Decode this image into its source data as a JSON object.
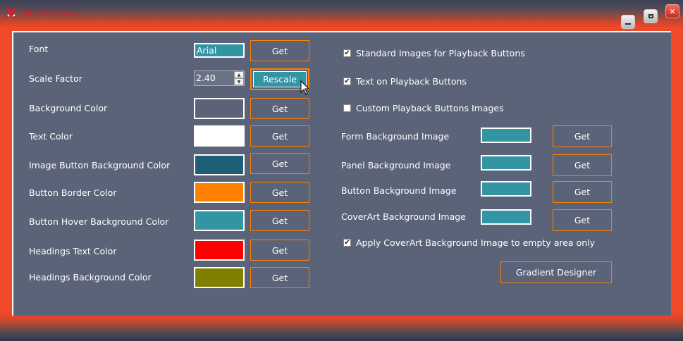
{
  "window": {
    "title": "Skin Settings",
    "minimize_icon": "minimize-icon",
    "maximize_icon": "maximize-icon",
    "close_icon": "close-icon"
  },
  "left": {
    "font": {
      "label": "Font",
      "value": "Arial",
      "get": "Get"
    },
    "scale": {
      "label": "Scale Factor",
      "value": "2.40",
      "button": "Rescale"
    },
    "colors": [
      {
        "label": "Background Color",
        "swatch": "#5a6377",
        "get": "Get"
      },
      {
        "label": "Text Color",
        "swatch": "#ffffff",
        "get": "Get"
      },
      {
        "label": "Image Button Background Color",
        "swatch": "#1e5f78",
        "get": "Get"
      },
      {
        "label": "Button Border Color",
        "swatch": "#ff8000",
        "get": "Get"
      },
      {
        "label": "Button Hover Background Color",
        "swatch": "#3394a4",
        "get": "Get"
      },
      {
        "label": "Headings Text Color",
        "swatch": "#ff0000",
        "get": "Get"
      },
      {
        "label": "Headings Background Color",
        "swatch": "#808000",
        "get": "Get"
      }
    ]
  },
  "right": {
    "checkboxes": [
      {
        "label": "Standard Images for Playback Buttons",
        "checked": true
      },
      {
        "label": "Text on Playback Buttons",
        "checked": true
      },
      {
        "label": "Custom Playback Buttons Images",
        "checked": false
      }
    ],
    "images": [
      {
        "label": "Form Background Image",
        "swatch": "#3394a4",
        "get": "Get"
      },
      {
        "label": "Panel Background Image",
        "swatch": "#3394a4",
        "get": "Get"
      },
      {
        "label": "Button Background Image",
        "swatch": "#3394a4",
        "get": "Get"
      },
      {
        "label": "CoverArt Background Image",
        "swatch": "#3394a4",
        "get": "Get"
      }
    ],
    "apply_checkbox": {
      "label": "Apply CoverArt Background Image to empty area only",
      "checked": true
    },
    "gradient_button": "Gradient Designer"
  }
}
